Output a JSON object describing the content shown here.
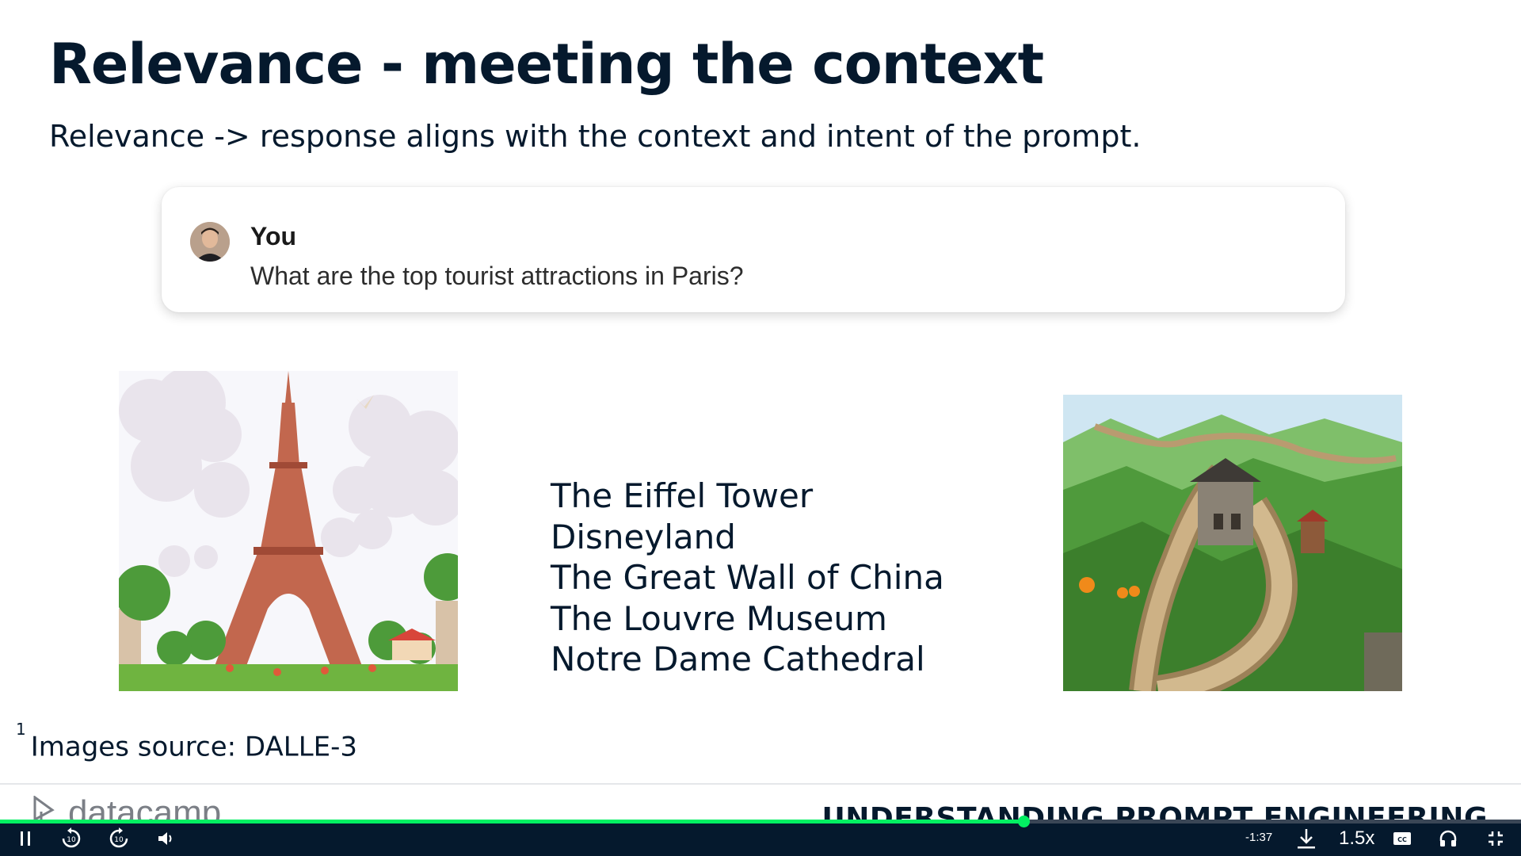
{
  "slide": {
    "title": "Relevance - meeting the context",
    "subtitle": "Relevance -> response aligns with the context and intent of the prompt.",
    "chat": {
      "user": "You",
      "message": "What are the top tourist attractions in Paris?"
    },
    "attractions": [
      "The Eiffel Tower",
      "Disneyland",
      "The Great Wall of China",
      "The Louvre Museum",
      "Notre Dame Cathedral"
    ],
    "footnote": {
      "marker": "1",
      "text": "Images source: DALLE-3"
    },
    "brand": "datacamp",
    "course_name": "UNDERSTANDING PROMPT ENGINEERING"
  },
  "player": {
    "progress_fraction": 0.673,
    "time_remaining": "-1:37",
    "speed": "1.5x",
    "accent_color": "#03ef62",
    "icons": [
      "pause-icon",
      "rewind-10-icon",
      "forward-10-icon",
      "volume-icon",
      "download-icon",
      "captions-icon",
      "headphones-icon",
      "exit-fullscreen-icon"
    ]
  },
  "colors": {
    "text_primary": "#05192d",
    "player_background": "#05192d",
    "progress": "#03ef62"
  }
}
